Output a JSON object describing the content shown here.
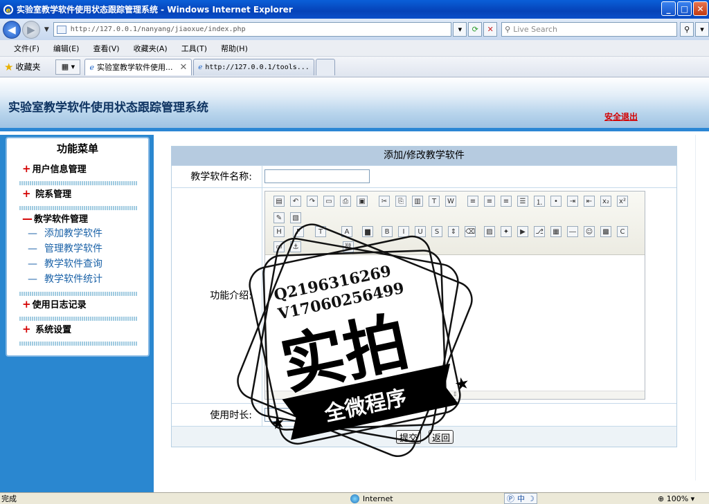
{
  "window": {
    "title": "实验室教学软件使用状态跟踪管理系统 - Windows Internet Explorer",
    "minimize": "_",
    "maximize": "□",
    "close": "✕"
  },
  "address_bar": {
    "url": "http://127.0.0.1/nanyang/jiaoxue/index.php",
    "search_placeholder": "Live Search"
  },
  "menu_bar": [
    "文件(F)",
    "编辑(E)",
    "查看(V)",
    "收藏夹(A)",
    "工具(T)",
    "帮助(H)"
  ],
  "favorites_bar": {
    "favorites_label": "收藏夹",
    "tabs": [
      {
        "label": "实验室教学软件使用...",
        "active": true
      },
      {
        "label": "http://127.0.0.1/tools...",
        "active": false
      }
    ]
  },
  "header": {
    "title": "实验室教学软件使用状态跟踪管理系统",
    "logout": "安全退出"
  },
  "sidebar": {
    "title": "功能菜单",
    "sections": [
      {
        "sign": "+",
        "label": "用户信息管理",
        "items": []
      },
      {
        "sign": "+",
        "label": "院系管理",
        "items": []
      },
      {
        "sign": "—",
        "label": "教学软件管理",
        "items": [
          "添加教学软件",
          "管理教学软件",
          "教学软件查询",
          "教学软件统计"
        ]
      },
      {
        "sign": "+",
        "label": "使用日志记录",
        "items": []
      },
      {
        "sign": "+",
        "label": "系统设置",
        "items": []
      }
    ],
    "item_dash": "—"
  },
  "form": {
    "title": "添加/修改教学软件",
    "name_label": "教学软件名称:",
    "intro_label": "功能介绍:",
    "duration_label": "使用时长:",
    "submit": "提交",
    "back": "返回"
  },
  "watermark": {
    "qq": "Q2196316269",
    "wechat": "V17060256499",
    "big_text": "实拍",
    "ribbon": "全微程序"
  },
  "status_bar": {
    "text": "完成",
    "zone": "Internet",
    "ime": "中",
    "zoom": "100%"
  }
}
